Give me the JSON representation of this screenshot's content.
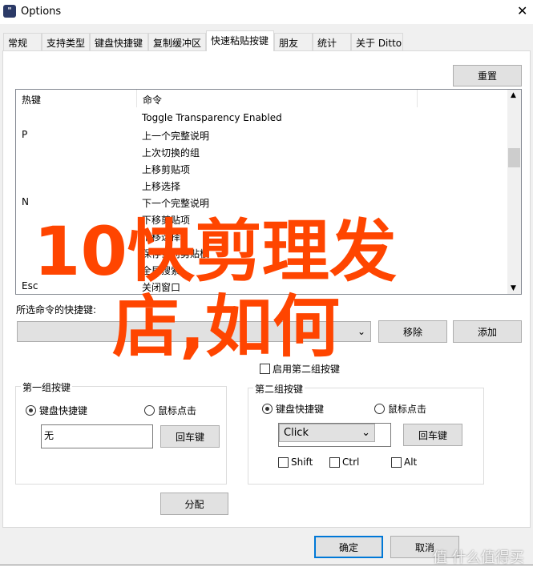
{
  "window": {
    "title": "Options",
    "close_icon": "close-icon"
  },
  "tabs": [
    {
      "label": "常规"
    },
    {
      "label": "支持类型"
    },
    {
      "label": "键盘快捷键"
    },
    {
      "label": "复制缓冲区"
    },
    {
      "label": "快速粘贴按键",
      "active": true
    },
    {
      "label": "朋友"
    },
    {
      "label": "统计"
    },
    {
      "label": "关于 Ditto"
    }
  ],
  "reset_label": "重置",
  "list": {
    "headers": [
      "热键",
      "命令"
    ],
    "rows": [
      {
        "key": "",
        "cmd": "Toggle Transparency Enabled"
      },
      {
        "key": "P",
        "cmd": "上一个完整说明"
      },
      {
        "key": "",
        "cmd": "上次切换的组"
      },
      {
        "key": "",
        "cmd": "上移剪贴项"
      },
      {
        "key": "",
        "cmd": "上移选择"
      },
      {
        "key": "N",
        "cmd": "下一个完整说明"
      },
      {
        "key": "",
        "cmd": "下移剪贴项"
      },
      {
        "key": "",
        "cmd": "下移选择"
      },
      {
        "key": "",
        "cmd": "保存当前剪贴板"
      },
      {
        "key": "",
        "cmd": "全局搜索"
      },
      {
        "key": "Esc",
        "cmd": "关闭窗口"
      }
    ]
  },
  "selected_label": "所选命令的快捷键:",
  "remove_label": "移除",
  "add_label": "添加",
  "enable_second_label": "启用第二组按键",
  "group1": {
    "title": "第一组按键",
    "radio_keyboard": "键盘快捷键",
    "radio_mouse": "鼠标点击",
    "value": "无",
    "enter_label": "回车键"
  },
  "group2": {
    "title": "第二组按键",
    "radio_keyboard": "键盘快捷键",
    "radio_mouse": "鼠标点击",
    "mouse_value": "Click",
    "enter_label": "回车键",
    "shift": "Shift",
    "ctrl": "Ctrl",
    "alt": "Alt"
  },
  "assign_label": "分配",
  "ok_label": "确定",
  "cancel_label": "取消",
  "overlay": {
    "line1": "10快剪理发",
    "line2": "店,如何",
    "color": "#ff4500"
  },
  "watermark": "值 什么值得买"
}
